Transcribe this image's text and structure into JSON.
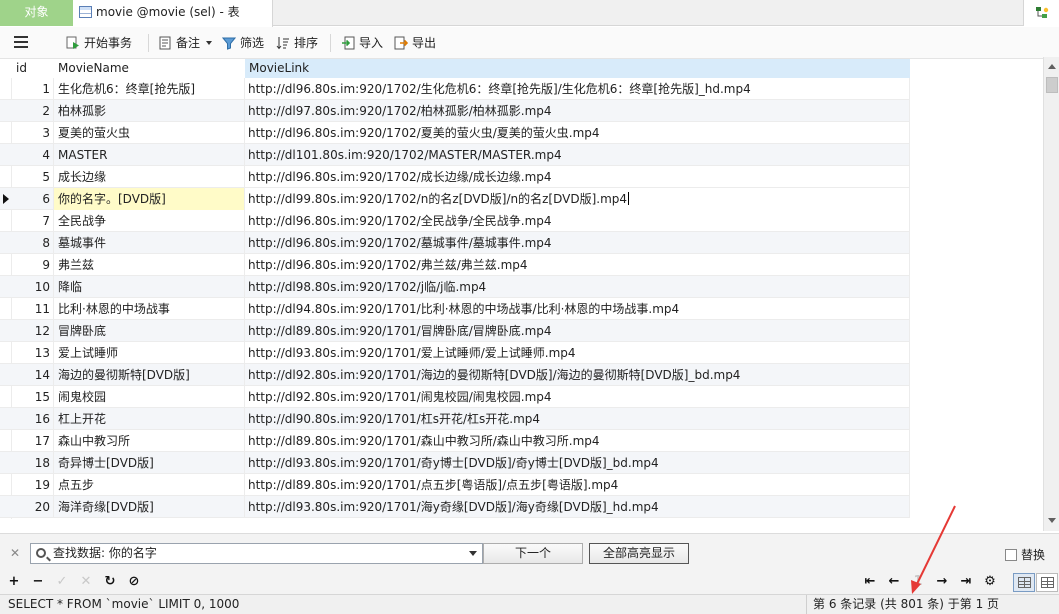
{
  "tabs": {
    "objects": "对象",
    "active": "movie @movie (sel) - 表"
  },
  "toolbar": {
    "begin_transaction": "开始事务",
    "memo": "备注",
    "filter": "筛选",
    "sort": "排序",
    "import": "导入",
    "export": "导出"
  },
  "columns": [
    "id",
    "MovieName",
    "MovieLink"
  ],
  "rows": [
    {
      "id": "1",
      "name": "生化危机6：终章[抢先版]",
      "link": "http://dl96.80s.im:920/1702/生化危机6：终章[抢先版]/生化危机6：终章[抢先版]_hd.mp4"
    },
    {
      "id": "2",
      "name": "柏林孤影",
      "link": "http://dl97.80s.im:920/1702/柏林孤影/柏林孤影.mp4"
    },
    {
      "id": "3",
      "name": "夏美的萤火虫",
      "link": "http://dl96.80s.im:920/1702/夏美的萤火虫/夏美的萤火虫.mp4"
    },
    {
      "id": "4",
      "name": "MASTER",
      "link": "http://dl101.80s.im:920/1702/MASTER/MASTER.mp4"
    },
    {
      "id": "5",
      "name": "成长边缘",
      "link": "http://dl96.80s.im:920/1702/成长边缘/成长边缘.mp4"
    },
    {
      "id": "6",
      "name": "你的名字。[DVD版]",
      "link": "http://dl99.80s.im:920/1702/n的名z[DVD版]/n的名z[DVD版].mp4"
    },
    {
      "id": "7",
      "name": "全民战争",
      "link": "http://dl96.80s.im:920/1702/全民战争/全民战争.mp4"
    },
    {
      "id": "8",
      "name": "墓城事件",
      "link": "http://dl96.80s.im:920/1702/墓城事件/墓城事件.mp4"
    },
    {
      "id": "9",
      "name": "弗兰兹",
      "link": "http://dl96.80s.im:920/1702/弗兰兹/弗兰兹.mp4"
    },
    {
      "id": "10",
      "name": "降临",
      "link": "http://dl98.80s.im:920/1702/j临/j临.mp4"
    },
    {
      "id": "11",
      "name": "比利·林恩的中场战事",
      "link": "http://dl94.80s.im:920/1701/比利·林恩的中场战事/比利·林恩的中场战事.mp4"
    },
    {
      "id": "12",
      "name": "冒牌卧底",
      "link": "http://dl89.80s.im:920/1701/冒牌卧底/冒牌卧底.mp4"
    },
    {
      "id": "13",
      "name": "爱上试睡师",
      "link": "http://dl93.80s.im:920/1701/爱上试睡师/爱上试睡师.mp4"
    },
    {
      "id": "14",
      "name": "海边的曼彻斯特[DVD版]",
      "link": "http://dl92.80s.im:920/1701/海边的曼彻斯特[DVD版]/海边的曼彻斯特[DVD版]_bd.mp4"
    },
    {
      "id": "15",
      "name": "闹鬼校园",
      "link": "http://dl92.80s.im:920/1701/闹鬼校园/闹鬼校园.mp4"
    },
    {
      "id": "16",
      "name": "杠上开花",
      "link": "http://dl90.80s.im:920/1701/杠s开花/杠s开花.mp4"
    },
    {
      "id": "17",
      "name": "森山中教习所",
      "link": "http://dl89.80s.im:920/1701/森山中教习所/森山中教习所.mp4"
    },
    {
      "id": "18",
      "name": "奇异博士[DVD版]",
      "link": "http://dl93.80s.im:920/1701/奇y博士[DVD版]/奇y博士[DVD版]_bd.mp4"
    },
    {
      "id": "19",
      "name": "点五步",
      "link": "http://dl89.80s.im:920/1701/点五步[粤语版]/点五步[粤语版].mp4"
    },
    {
      "id": "20",
      "name": "海洋奇缘[DVD版]",
      "link": "http://dl93.80s.im:920/1701/海y奇缘[DVD版]/海y奇缘[DVD版]_hd.mp4"
    }
  ],
  "current_row": 6,
  "find": {
    "value": "查找数据: 你的名字",
    "next_label": "下一个",
    "highlight_label": "全部高亮显示",
    "replace_label": "替换"
  },
  "status": {
    "sql": "SELECT * FROM `movie` LIMIT 0, 1000",
    "record": "第 6 条记录 (共 801 条) 于第 1 页"
  },
  "colors": {
    "objects_tab": "#9fd38a",
    "selected_header": "#d8ebfa",
    "current_cell": "#fffbc8",
    "annotation_arrow": "#e53935"
  }
}
